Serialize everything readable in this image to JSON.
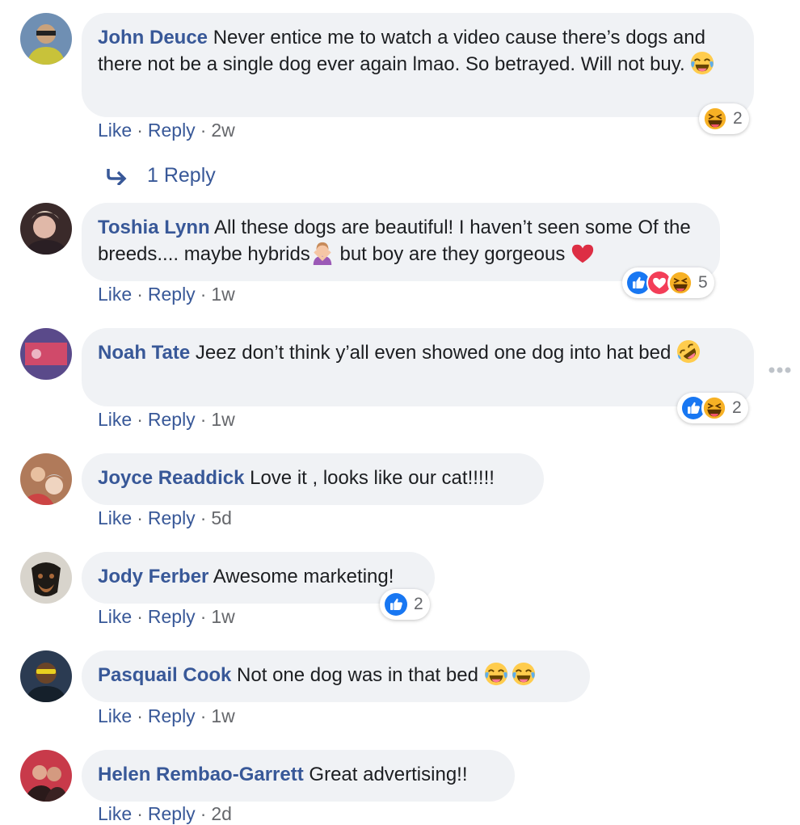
{
  "actions": {
    "like": "Like",
    "reply": "Reply",
    "sep": "·"
  },
  "comments": [
    {
      "author": "John Deuce",
      "text": "Never entice me to watch a video cause there’s dogs and there not be a single dog ever again lmao. So betrayed. Will not buy.",
      "inline_emoji": [
        "tears-of-joy"
      ],
      "time": "2w",
      "reactions": {
        "icons": [
          "haha"
        ],
        "count": "2"
      }
    },
    {
      "author": "Toshia Lynn",
      "text_a": "All these dogs are beautiful! I haven’t seen some Of the breeds.... maybe hybrids",
      "text_b": " but boy are they gorgeous ",
      "inline_emoji": [
        "person-gesturing-no",
        "red-heart"
      ],
      "time": "1w",
      "reactions": {
        "icons": [
          "like",
          "love",
          "haha"
        ],
        "count": "5"
      }
    },
    {
      "author": "Noah Tate",
      "text": "Jeez don’t think y’all even showed one dog into hat bed",
      "inline_emoji": [
        "rolling-on-floor-laughing"
      ],
      "time": "1w",
      "reactions": {
        "icons": [
          "like",
          "haha"
        ],
        "count": "2"
      }
    },
    {
      "author": "Joyce Readdick",
      "text": "Love it , looks like our cat!!!!!",
      "time": "5d"
    },
    {
      "author": "Jody Ferber",
      "text": "Awesome marketing!",
      "time": "1w",
      "reactions": {
        "icons": [
          "like"
        ],
        "count": "2"
      }
    },
    {
      "author": "Pasquail Cook",
      "text": "Not one dog was in that bed",
      "inline_emoji": [
        "tears-of-joy",
        "tears-of-joy"
      ],
      "time": "1w"
    },
    {
      "author": "Helen Rembao-Garrett",
      "text": "Great advertising!!",
      "time": "2d"
    }
  ],
  "reply_thread": {
    "label": "1 Reply",
    "icon": "reply-arrow-icon"
  },
  "colors": {
    "link": "#385898",
    "bubble": "#f0f2f5",
    "meta": "#65676b",
    "like_blue": "#1877f2",
    "love_red": "#f33e58",
    "haha_yellow": "#f7b125"
  }
}
